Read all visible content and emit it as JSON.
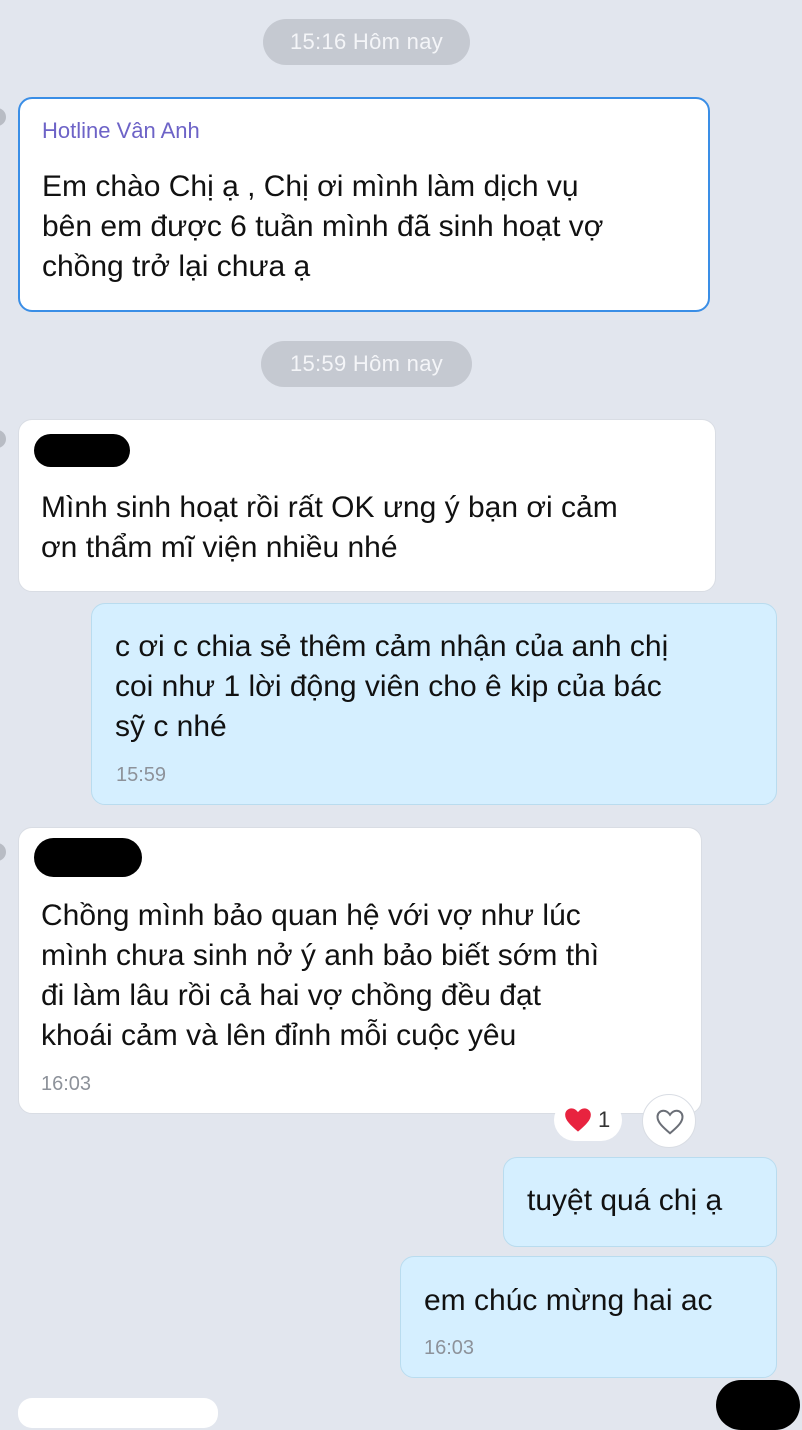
{
  "separators": [
    {
      "label": "15:16 Hôm nay"
    },
    {
      "label": "15:59 Hôm nay"
    }
  ],
  "messages": [
    {
      "direction": "in",
      "sender": "Hotline Vân Anh",
      "lines": [
        "Em chào Chị ạ , Chị ơi mình làm dịch vụ",
        "bên em được 6 tuần mình đã sinh hoạt vợ",
        "chồng trở lại chưa ạ"
      ]
    },
    {
      "direction": "in",
      "sender_redacted": true,
      "lines": [
        "Mình sinh hoạt rồi rất OK ưng ý bạn ơi cảm",
        "ơn thẩm mĩ viện nhiều nhé"
      ]
    },
    {
      "direction": "out",
      "lines": [
        "c ơi c chia sẻ thêm cảm nhận của anh chị",
        "coi như 1 lời động viên cho ê kip của bác",
        "sỹ c nhé"
      ],
      "time": "15:59"
    },
    {
      "direction": "in",
      "sender_redacted": true,
      "lines": [
        "Chồng mình bảo quan hệ với vợ như lúc",
        "mình chưa sinh nở ý anh bảo biết sớm thì",
        "đi làm lâu rồi cả hai vợ chồng đều đạt",
        "khoái cảm và lên đỉnh mỗi cuộc yêu"
      ],
      "time": "16:03",
      "reaction": {
        "icon": "heart-icon",
        "count": "1",
        "color": "#e8233f"
      }
    },
    {
      "direction": "out",
      "lines": [
        "tuyệt quá chị ạ"
      ]
    },
    {
      "direction": "out",
      "lines": [
        "em chúc mừng hai ac"
      ],
      "time": "16:03"
    }
  ],
  "colors": {
    "background": "#e2e6ee",
    "incoming_bubble": "#ffffff",
    "outgoing_bubble": "#d5efff",
    "highlight_border": "#3a8ee6",
    "sender_name": "#6d63c7",
    "timestamp": "#8d929a"
  }
}
